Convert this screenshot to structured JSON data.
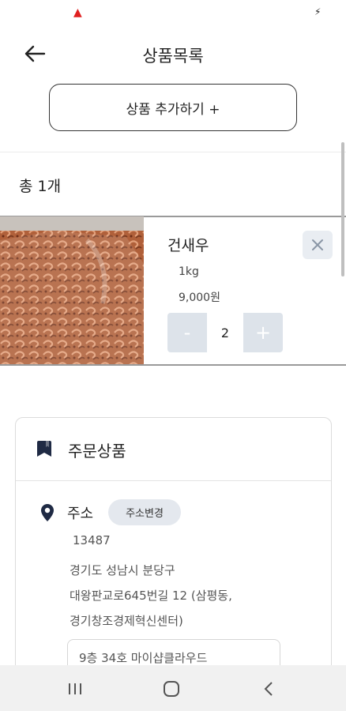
{
  "header": {
    "title": "상품목록"
  },
  "add_button": {
    "label": "상품 추가하기 +"
  },
  "list": {
    "total_label": "총 1개"
  },
  "products": [
    {
      "name": "건새우",
      "weight": "1kg",
      "price": "9,000원",
      "quantity": "2",
      "minus": "-",
      "plus": "+"
    }
  ],
  "order_card": {
    "title": "주문상품",
    "address_label": "주소",
    "address_change": "주소변경",
    "zip": "13487",
    "address_lines": [
      "경기도 성남시 분당구",
      "대왕판교로645번길 12 (삼평동,",
      "경기창조경제혁신센터)"
    ],
    "detail_address": "9층 34호 마이샵클라우드"
  },
  "colors": {
    "accent_navy": "#1f2a44",
    "stepper_bg": "#dde3ea",
    "chip_bg": "#e4e8ee",
    "notification_red": "#e02020"
  }
}
